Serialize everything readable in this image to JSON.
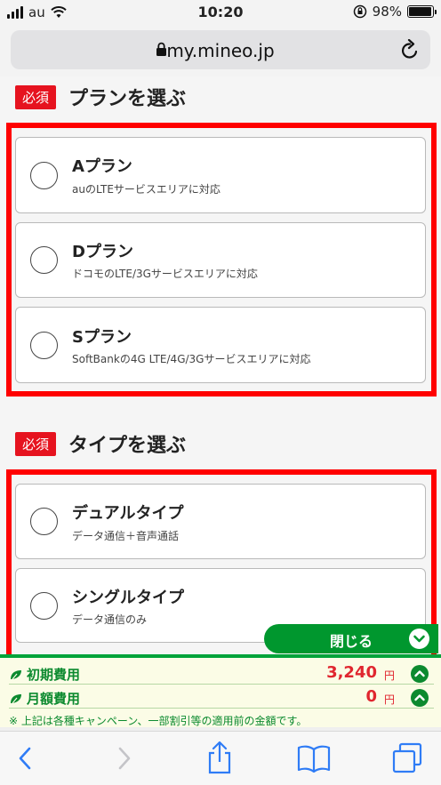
{
  "status_bar": {
    "carrier": "au",
    "time": "10:20",
    "battery": "98%",
    "battery_level": 0.98
  },
  "browser": {
    "url": "my.mineo.jp"
  },
  "plan_section": {
    "required_badge": "必須",
    "title": "プランを選ぶ",
    "options": [
      {
        "title": "Aプラン",
        "desc": "auのLTEサービスエリアに対応"
      },
      {
        "title": "Dプラン",
        "desc": "ドコモのLTE/3Gサービスエリアに対応"
      },
      {
        "title": "Sプラン",
        "desc": "SoftBankの4G LTE/4G/3Gサービスエリアに対応"
      }
    ]
  },
  "type_section": {
    "required_badge": "必須",
    "title": "タイプを選ぶ",
    "options": [
      {
        "title": "デュアルタイプ",
        "desc": "データ通信＋音声通話"
      },
      {
        "title": "シングルタイプ",
        "desc": "データ通信のみ"
      }
    ]
  },
  "close_panel": {
    "label": "閉じる"
  },
  "summary": {
    "rows": [
      {
        "label": "初期費用",
        "value": "3,240",
        "unit": "円"
      },
      {
        "label": "月額費用",
        "value": "0",
        "unit": "円"
      }
    ],
    "note": "※ 上記は各種キャンペーン、一部割引等の適用前の金額です。"
  },
  "colors": {
    "required_red": "#e6131f",
    "highlight_frame": "#ff0000",
    "mineo_green": "#00972e",
    "price_red": "#e0262f",
    "ios_blue": "#2f7cf6"
  },
  "toolbar": {
    "icons": [
      "back-icon",
      "forward-icon",
      "share-icon",
      "bookmarks-icon",
      "tabs-icon"
    ]
  }
}
